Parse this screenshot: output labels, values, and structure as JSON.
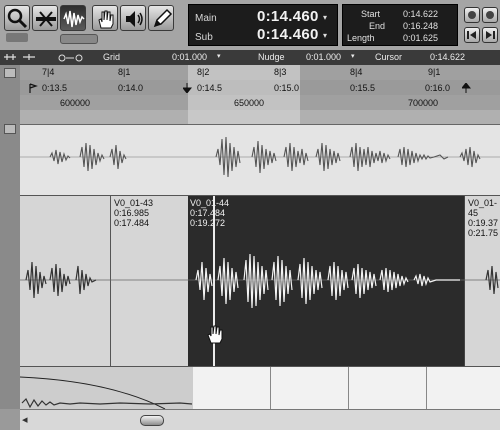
{
  "toolbar": {
    "tools": [
      {
        "name": "zoom-tool",
        "icon": "magnifier-icon"
      },
      {
        "name": "trim-tool",
        "icon": "trim-icon"
      },
      {
        "name": "selector-tool",
        "icon": "waveform-selector-icon"
      },
      {
        "name": "grabber-tool",
        "icon": "hand-icon"
      },
      {
        "name": "scrubber-tool",
        "icon": "speaker-icon"
      },
      {
        "name": "pencil-tool",
        "icon": "pencil-icon"
      }
    ]
  },
  "counter": {
    "main_label": "Main",
    "main_value": "0:14.460",
    "sub_label": "Sub",
    "sub_value": "0:14.460"
  },
  "selection": {
    "start_label": "Start",
    "start_value": "0:14.622",
    "end_label": "End",
    "end_value": "0:16.248",
    "length_label": "Length",
    "length_value": "0:01.625"
  },
  "grid_bar": {
    "grid_label": "Grid",
    "grid_value": "0:01.000",
    "nudge_label": "Nudge",
    "nudge_value": "0:01.000",
    "cursor_label": "Cursor",
    "cursor_value": "0:14.622"
  },
  "rulers": {
    "bars": [
      "7|4",
      "8|1",
      "8|2",
      "8|3",
      "8|4",
      "9|1"
    ],
    "minsecs": [
      "0:13.5",
      "0:14.0",
      "0:14.5",
      "0:15.0",
      "0:15.5",
      "0:16.0"
    ],
    "samples": [
      "600000",
      "650000",
      "700000"
    ]
  },
  "clips": [
    {
      "name": "V0_01-43",
      "start": "0:16.985",
      "end": "0:17.484"
    },
    {
      "name": "V0_01-44",
      "start": "0:17.484",
      "end": "0:19.272"
    },
    {
      "name": "V0_01-45",
      "start": "0:19.37",
      "end": "0:21.75"
    }
  ]
}
